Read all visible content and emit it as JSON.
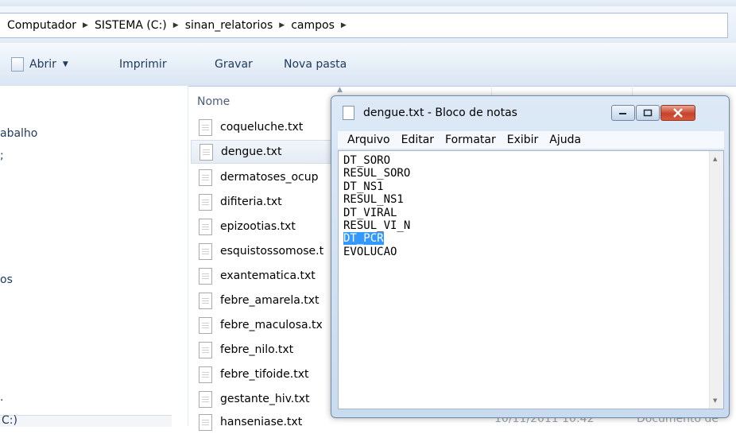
{
  "explorer": {
    "breadcrumb": [
      "Computador",
      "SISTEMA (C:)",
      "sinan_relatorios",
      "campos"
    ],
    "toolbar": {
      "open_label": "Abrir",
      "print_label": "Imprimir",
      "burn_label": "Gravar",
      "new_folder_label": "Nova pasta"
    },
    "nav_items": [
      "abalho",
      ";",
      "os",
      ".",
      "C:)"
    ],
    "column_name": "Nome",
    "files": [
      "coqueluche.txt",
      "dengue.txt",
      "dermatoses_ocup",
      "difiteria.txt",
      "epizootias.txt",
      "esquistossomose.t",
      "exantematica.txt",
      "febre_amarela.txt",
      "febre_maculosa.tx",
      "febre_nilo.txt",
      "febre_tifoide.txt",
      "gestante_hiv.txt",
      "hanseniase.txt"
    ],
    "background_date": "10/11/2011 10:42",
    "background_type": "Documento de"
  },
  "notepad": {
    "title": "dengue.txt - Bloco de notas",
    "menu": [
      "Arquivo",
      "Editar",
      "Formatar",
      "Exibir",
      "Ajuda"
    ],
    "lines": [
      "DT_SORO",
      "RESUL_SORO",
      "DT_NS1",
      "RESUL_NS1",
      "DT_VIRAL",
      "RESUL_VI_N",
      "DT_PCR",
      "EVOLUCAO"
    ],
    "selected_line": "DT_PCR"
  },
  "colors": {
    "selection": "#3399ff",
    "close_button": "#c7432b",
    "explorer_text": "#1e395b"
  },
  "icons": {
    "open": "text-file-icon",
    "breadcrumb_separator": "triangle-right",
    "file": "text-file-icon",
    "close": "x"
  }
}
